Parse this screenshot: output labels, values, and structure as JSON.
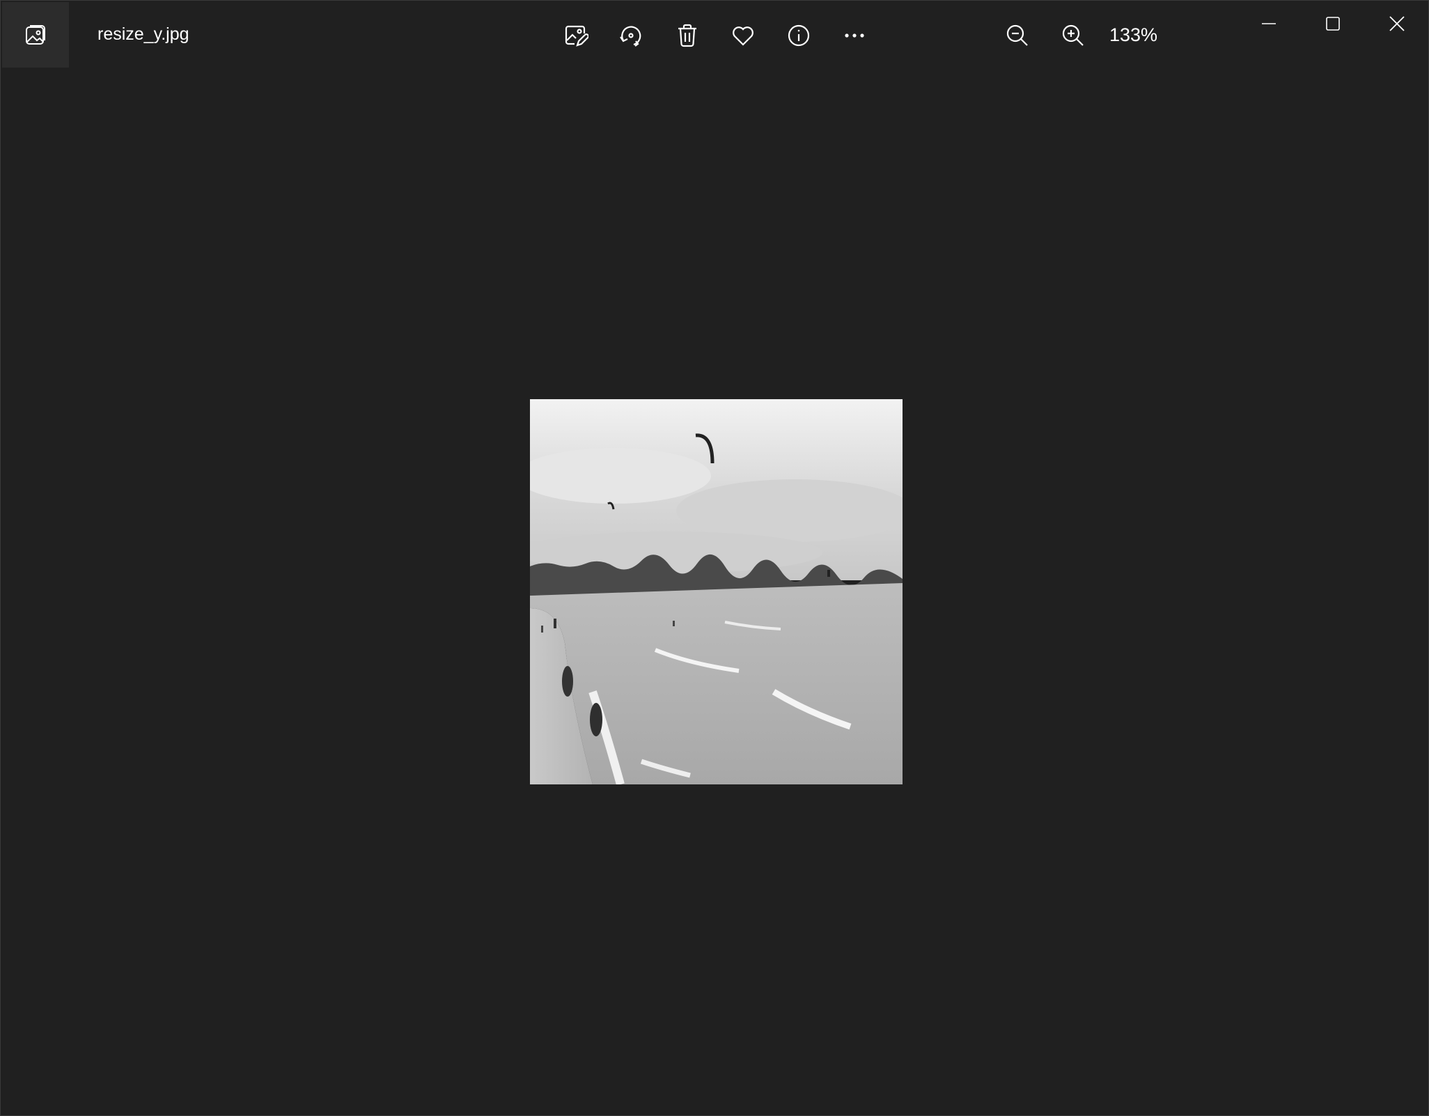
{
  "window": {
    "title": "resize_y.jpg",
    "zoom_level": "133%"
  },
  "toolbar": {
    "icons": [
      "edit-image-icon",
      "rotate-icon",
      "delete-icon",
      "favorite-icon",
      "info-icon",
      "more-icon"
    ]
  },
  "zoom": {
    "icons": [
      "zoom-out-icon",
      "zoom-in-icon"
    ]
  },
  "window_controls": {
    "icons": [
      "minimize-icon",
      "maximize-icon",
      "close-icon"
    ]
  },
  "colors": {
    "background": "#202020",
    "icon": "#ffffff",
    "app_icon_bg": "#2c2c2c"
  }
}
